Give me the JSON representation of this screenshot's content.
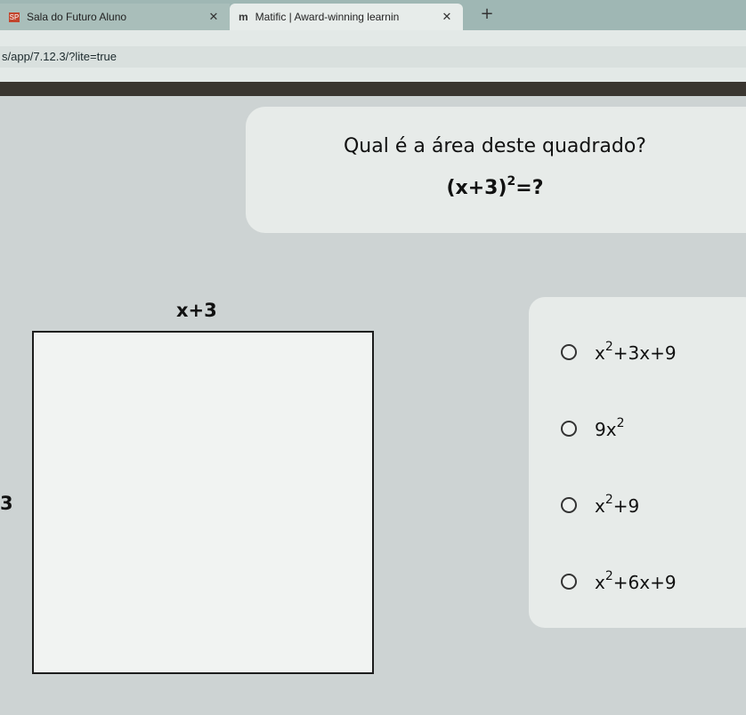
{
  "browser": {
    "tabs": [
      {
        "title": "Sala do Futuro Aluno",
        "favicon": "SP"
      },
      {
        "title": "Matific | Award-winning learnin",
        "favicon": "m"
      }
    ],
    "url": "s/app/7.12.3/?lite=true"
  },
  "question": {
    "title": "Qual é a área deste quadrado?",
    "expression_base": "(x+3)",
    "expression_exp": "2",
    "expression_tail": "=?"
  },
  "figure": {
    "top_label": "x+3",
    "left_label": "3"
  },
  "options": [
    {
      "base": "x",
      "exp": "2",
      "rest": "+3x+9"
    },
    {
      "base": "9x",
      "exp": "2",
      "rest": ""
    },
    {
      "base": "x",
      "exp": "2",
      "rest": "+9"
    },
    {
      "base": "x",
      "exp": "2",
      "rest": "+6x+9"
    }
  ],
  "colors": {
    "background": "#cdd3d3",
    "card": "#e7ebe9",
    "tabbar": "#9fb7b4"
  }
}
